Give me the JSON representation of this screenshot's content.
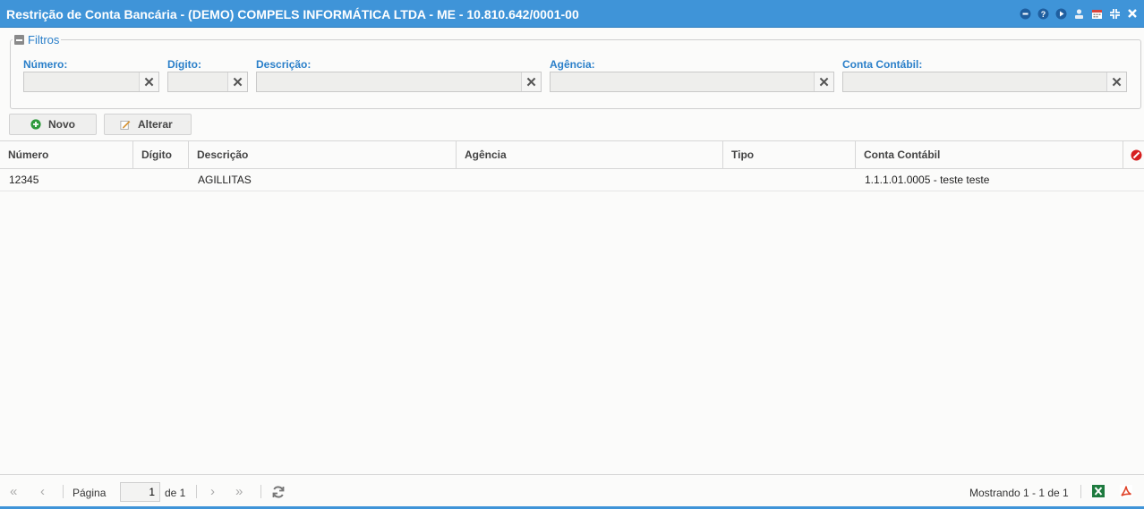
{
  "window": {
    "title": "Restrição de Conta Bancária - (DEMO) COMPELS INFORMÁTICA LTDA - ME - 10.810.642/0001-00",
    "icons": [
      "minimize-icon",
      "help-icon",
      "play-icon",
      "user-icon",
      "calendar-icon",
      "collapse-icon",
      "close-icon"
    ]
  },
  "filters": {
    "legend": "Filtros",
    "fields": [
      {
        "label": "Número:",
        "value": "",
        "placeholder": ""
      },
      {
        "label": "Dígito:",
        "value": "",
        "placeholder": ""
      },
      {
        "label": "Descrição:",
        "value": "",
        "placeholder": ""
      },
      {
        "label": "Agência:",
        "value": "",
        "placeholder": ""
      },
      {
        "label": "Conta Contábil:",
        "value": "",
        "placeholder": ""
      }
    ],
    "clear_glyph": "✕"
  },
  "toolbar": {
    "new_label": "Novo",
    "edit_label": "Alterar"
  },
  "grid": {
    "columns": [
      "Número",
      "Dígito",
      "Descrição",
      "Agência",
      "Tipo",
      "Conta Contábil"
    ],
    "rows": [
      {
        "numero": "12345",
        "digito": "",
        "descricao": "AGILLITAS",
        "agencia": "",
        "tipo": "",
        "conta": "1.1.1.01.0005 - teste teste"
      }
    ]
  },
  "pager": {
    "page_label": "Página",
    "page_value": "1",
    "of_label": "de 1",
    "status": "Mostrando 1 - 1 de 1"
  },
  "colors": {
    "titlebar": "#3f94d8",
    "label_blue": "#2a7fc9",
    "excel_green": "#1d7a3e",
    "pdf_red": "#e0452b"
  }
}
